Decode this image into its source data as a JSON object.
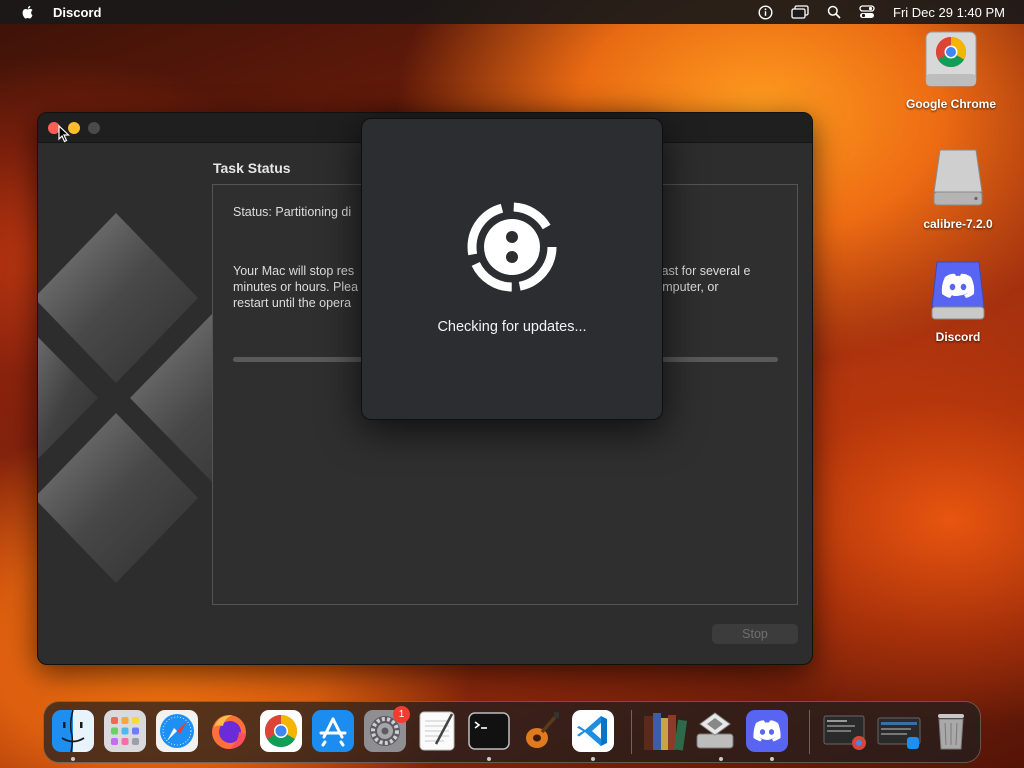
{
  "menubar": {
    "app_name": "Discord",
    "clock": "Fri Dec 29  1:40 PM",
    "icons": [
      "apple-icon",
      "info-icon",
      "screens-icon",
      "spotlight-icon",
      "control-center-icon"
    ]
  },
  "desktop": {
    "icons": [
      {
        "label": "Google Chrome",
        "icon": "chrome-drive-icon"
      },
      {
        "label": "calibre-7.2.0",
        "icon": "disk-drive-icon"
      },
      {
        "label": "Discord",
        "icon": "discord-drive-icon"
      }
    ]
  },
  "window": {
    "task_title": "Task Status",
    "status_text": "Status: Partitioning di",
    "desc_left": "Your Mac will stop res minutes or hours. Plea restart until the opera",
    "desc_right": "y last for several e computer, or",
    "progress_percent": 0,
    "stop_label": "Stop"
  },
  "updater": {
    "message": "Checking for updates..."
  },
  "dock": {
    "items": [
      {
        "name": "finder",
        "running": true
      },
      {
        "name": "launchpad",
        "running": false
      },
      {
        "name": "safari",
        "running": false
      },
      {
        "name": "firefox",
        "running": false
      },
      {
        "name": "chrome",
        "running": false
      },
      {
        "name": "app-store",
        "running": false
      },
      {
        "name": "system-settings",
        "running": false,
        "badge": "1"
      },
      {
        "name": "textedit",
        "running": false
      },
      {
        "name": "terminal",
        "running": true
      },
      {
        "name": "garageband",
        "running": false
      },
      {
        "name": "vscode",
        "running": true
      },
      {
        "name": "calibre",
        "running": false
      },
      {
        "name": "boot-camp-assistant",
        "running": true
      },
      {
        "name": "discord",
        "running": true
      },
      {
        "name": "chrome-window-preview",
        "running": false
      },
      {
        "name": "finder-window-preview",
        "running": false
      },
      {
        "name": "trash",
        "running": false
      }
    ]
  }
}
